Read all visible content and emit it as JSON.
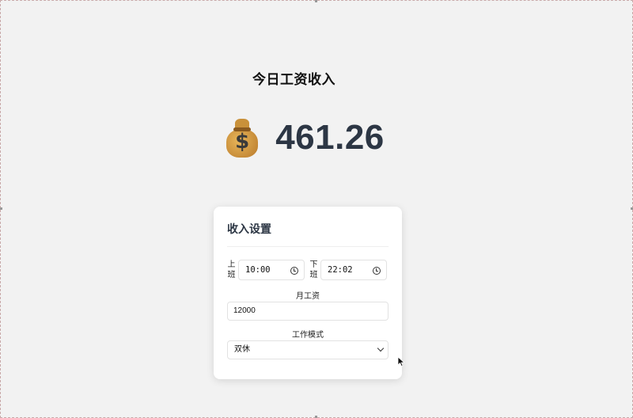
{
  "header": {
    "title": "今日工资收入"
  },
  "earnings": {
    "icon": "money-bag-icon",
    "amount": "461.26"
  },
  "settings": {
    "title": "收入设置",
    "start_label": "上班",
    "start_time": "10:00",
    "end_label": "下班",
    "end_time": "22:02",
    "salary_label": "月工资",
    "salary_value": "12000",
    "mode_label": "工作模式",
    "mode_value": "双休"
  },
  "colors": {
    "amount": "#2c3644",
    "background": "#f2f2f2",
    "card": "#ffffff"
  }
}
